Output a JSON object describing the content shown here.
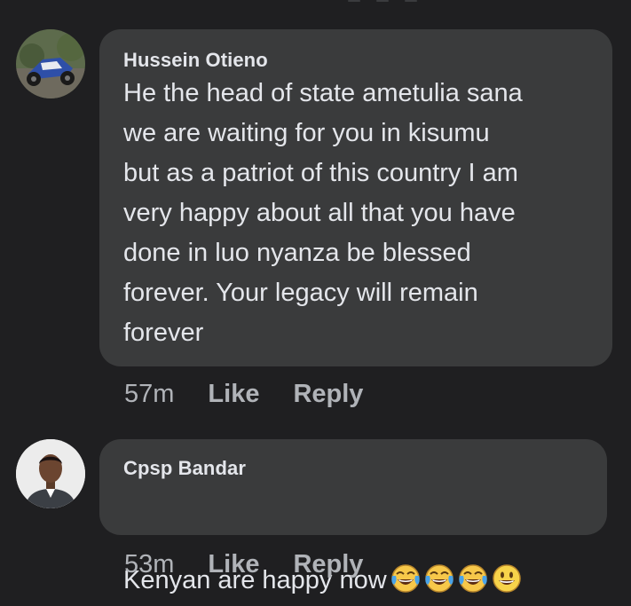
{
  "comments": [
    {
      "author": "Hussein Otieno",
      "text": "He the head of state ametulia sana\nwe are waiting for you in kisumu\nbut as a patriot of this country I am\nvery happy about all that you have\ndone in luo nyanza be blessed\nforever. Your legacy will remain\nforever",
      "time": "57m",
      "like_label": "Like",
      "reply_label": "Reply",
      "avatar_icon": "motorcycle-photo-avatar"
    },
    {
      "author": "Cpsp Bandar",
      "text": "Kenyan are happy now",
      "emojis": [
        "face-with-tears-of-joy",
        "face-with-tears-of-joy",
        "face-with-tears-of-joy",
        "grinning-face"
      ],
      "time": "53m",
      "like_label": "Like",
      "reply_label": "Reply",
      "avatar_icon": "man-portrait-avatar"
    }
  ],
  "colors": {
    "background": "#1f1f21",
    "bubble": "#3a3b3c",
    "text": "#e4e6eb",
    "secondary_text": "#b0b3b8"
  }
}
